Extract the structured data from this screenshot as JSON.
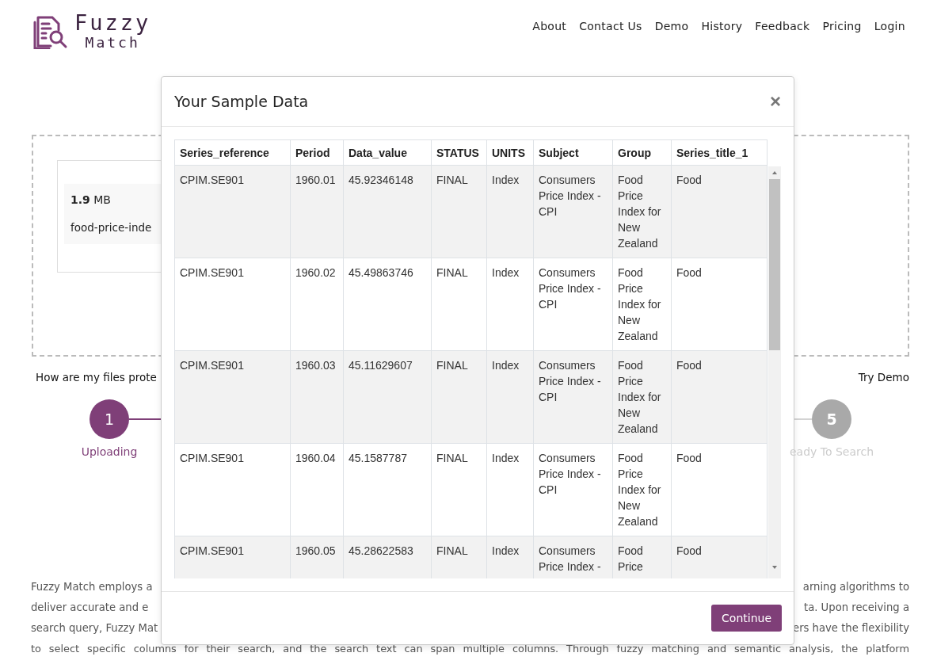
{
  "header": {
    "logo": {
      "line_1": "Fuzzy",
      "line_2": "Match"
    },
    "nav": [
      "About",
      "Contact Us",
      "Demo",
      "History",
      "Feedback",
      "Pricing",
      "Login"
    ]
  },
  "upload": {
    "file": {
      "size": "1.9",
      "unit": "MB",
      "name": "food-price-inde"
    },
    "help_link": "How are my files prote",
    "demo_link": "Try Demo"
  },
  "steps": [
    {
      "number": "1",
      "label": "Uploading",
      "selected": true
    },
    {
      "number": "5",
      "label": "eady To Search",
      "selected": false
    }
  ],
  "description": {
    "lines": [
      {
        "left": "Fuzzy Match employs a",
        "right": "arning algorithms to"
      },
      {
        "left": "deliver accurate and e",
        "right": "ta. Upon receiving a"
      },
      {
        "left": "search query, Fuzzy Mat",
        "right": "ers have the flexibility"
      },
      {
        "full": "to select specific columns for their search, and the search text can span multiple columns. Through fuzzy matching and semantic analysis, the platform"
      }
    ]
  },
  "modal": {
    "title": "Your Sample Data",
    "close": "×",
    "table": {
      "columns": [
        "Series_reference",
        "Period",
        "Data_value",
        "STATUS",
        "UNITS",
        "Subject",
        "Group",
        "Series_title_1"
      ],
      "rows": [
        [
          "CPIM.SE901",
          "1960.01",
          "45.92346148",
          "FINAL",
          "Index",
          "Consumers Price Index - CPI",
          "Food Price Index for New Zealand",
          "Food"
        ],
        [
          "CPIM.SE901",
          "1960.02",
          "45.49863746",
          "FINAL",
          "Index",
          "Consumers Price Index - CPI",
          "Food Price Index for New Zealand",
          "Food"
        ],
        [
          "CPIM.SE901",
          "1960.03",
          "45.11629607",
          "FINAL",
          "Index",
          "Consumers Price Index - CPI",
          "Food Price Index for New Zealand",
          "Food"
        ],
        [
          "CPIM.SE901",
          "1960.04",
          "45.1587787",
          "FINAL",
          "Index",
          "Consumers Price Index - CPI",
          "Food Price Index for New Zealand",
          "Food"
        ],
        [
          "CPIM.SE901",
          "1960.05",
          "45.28622583",
          "FINAL",
          "Index",
          "Consumers Price Index -",
          "Food Price",
          "Food"
        ]
      ]
    },
    "button": "Continue"
  }
}
